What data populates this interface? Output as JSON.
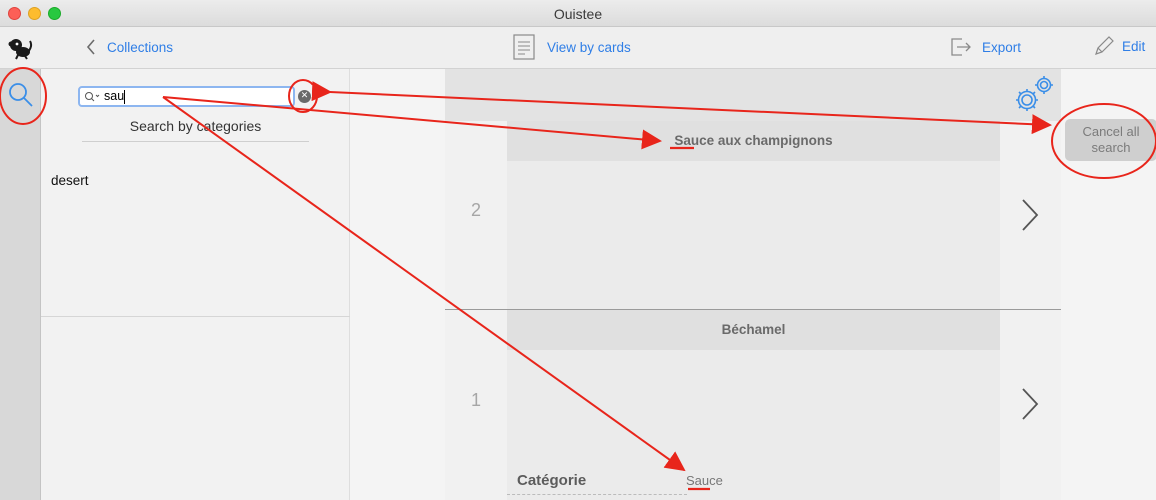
{
  "window": {
    "title": "Ouistee"
  },
  "toolbar": {
    "back_label": "Collections",
    "view_label": "View by cards",
    "export_label": "Export",
    "edit_label": "Edit"
  },
  "search": {
    "value": "sau",
    "by_categories_label": "Search by categories"
  },
  "sidebar": {
    "items": [
      {
        "label": "desert"
      }
    ]
  },
  "cards": [
    {
      "number": "2",
      "title": "Sauce aux champignons"
    },
    {
      "number": "1",
      "title": "Béchamel",
      "field_label": "Catégorie",
      "field_value": "Sauce"
    }
  ],
  "actions": {
    "cancel_all_search": "Cancel all search"
  },
  "colors": {
    "accent": "#2f7ee6",
    "annotation": "#e8251b"
  }
}
